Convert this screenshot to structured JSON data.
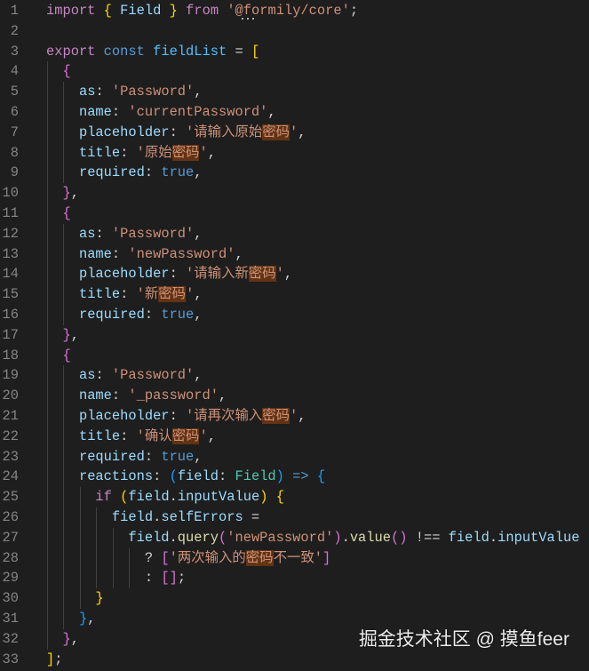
{
  "editor": {
    "colors": {
      "background": "#1e1e1e",
      "text": "#d4d4d4",
      "line_number": "#858585",
      "indent_guide": "#404040",
      "find_match": "#623314"
    },
    "lines": [
      {
        "n": "1",
        "tokens": [
          {
            "text": "import",
            "color": "#c586c0"
          },
          {
            "text": " "
          },
          {
            "text": "{",
            "color": "#ffd700"
          },
          {
            "text": " "
          },
          {
            "text": "Field",
            "color": "#9cdcfe"
          },
          {
            "text": " "
          },
          {
            "text": "}",
            "color": "#ffd700"
          },
          {
            "text": " "
          },
          {
            "text": "from",
            "color": "#c586c0"
          },
          {
            "text": " "
          },
          {
            "text": "'@formily/core'",
            "color": "#ce9178"
          },
          {
            "text": ";"
          }
        ]
      },
      {
        "n": "2",
        "tokens": []
      },
      {
        "n": "3",
        "tokens": [
          {
            "text": "export",
            "color": "#c586c0"
          },
          {
            "text": " "
          },
          {
            "text": "const",
            "color": "#569cd6"
          },
          {
            "text": " "
          },
          {
            "text": "fieldList",
            "color": "#4fc1ff"
          },
          {
            "text": " = "
          },
          {
            "text": "[",
            "color": "#ffd700"
          }
        ]
      },
      {
        "n": "4",
        "tokens": [
          {
            "text": "  "
          },
          {
            "text": "{",
            "color": "#da70d6"
          }
        ]
      },
      {
        "n": "5",
        "tokens": [
          {
            "text": "    "
          },
          {
            "text": "as",
            "color": "#9cdcfe"
          },
          {
            "text": ": "
          },
          {
            "text": "'Password'",
            "color": "#ce9178"
          },
          {
            "text": ","
          }
        ]
      },
      {
        "n": "6",
        "tokens": [
          {
            "text": "    "
          },
          {
            "text": "name",
            "color": "#9cdcfe"
          },
          {
            "text": ": "
          },
          {
            "text": "'currentPassword'",
            "color": "#ce9178"
          },
          {
            "text": ","
          }
        ]
      },
      {
        "n": "7",
        "tokens": [
          {
            "text": "    "
          },
          {
            "text": "placeholder",
            "color": "#9cdcfe"
          },
          {
            "text": ": "
          },
          {
            "text": "'请输入原始",
            "color": "#ce9178"
          },
          {
            "text": "密码",
            "color": "#ce9178",
            "match": true
          },
          {
            "text": "'",
            "color": "#ce9178"
          },
          {
            "text": ","
          }
        ]
      },
      {
        "n": "8",
        "tokens": [
          {
            "text": "    "
          },
          {
            "text": "title",
            "color": "#9cdcfe"
          },
          {
            "text": ": "
          },
          {
            "text": "'原始",
            "color": "#ce9178"
          },
          {
            "text": "密码",
            "color": "#ce9178",
            "match": true
          },
          {
            "text": "'",
            "color": "#ce9178"
          },
          {
            "text": ","
          }
        ]
      },
      {
        "n": "9",
        "tokens": [
          {
            "text": "    "
          },
          {
            "text": "required",
            "color": "#9cdcfe"
          },
          {
            "text": ": "
          },
          {
            "text": "true",
            "color": "#569cd6"
          },
          {
            "text": ","
          }
        ]
      },
      {
        "n": "10",
        "tokens": [
          {
            "text": "  "
          },
          {
            "text": "}",
            "color": "#da70d6"
          },
          {
            "text": ","
          }
        ]
      },
      {
        "n": "11",
        "tokens": [
          {
            "text": "  "
          },
          {
            "text": "{",
            "color": "#da70d6"
          }
        ]
      },
      {
        "n": "12",
        "tokens": [
          {
            "text": "    "
          },
          {
            "text": "as",
            "color": "#9cdcfe"
          },
          {
            "text": ": "
          },
          {
            "text": "'Password'",
            "color": "#ce9178"
          },
          {
            "text": ","
          }
        ]
      },
      {
        "n": "13",
        "tokens": [
          {
            "text": "    "
          },
          {
            "text": "name",
            "color": "#9cdcfe"
          },
          {
            "text": ": "
          },
          {
            "text": "'newPassword'",
            "color": "#ce9178"
          },
          {
            "text": ","
          }
        ]
      },
      {
        "n": "14",
        "tokens": [
          {
            "text": "    "
          },
          {
            "text": "placeholder",
            "color": "#9cdcfe"
          },
          {
            "text": ": "
          },
          {
            "text": "'请输入新",
            "color": "#ce9178"
          },
          {
            "text": "密码",
            "color": "#ce9178",
            "match": true
          },
          {
            "text": "'",
            "color": "#ce9178"
          },
          {
            "text": ","
          }
        ]
      },
      {
        "n": "15",
        "tokens": [
          {
            "text": "    "
          },
          {
            "text": "title",
            "color": "#9cdcfe"
          },
          {
            "text": ": "
          },
          {
            "text": "'新",
            "color": "#ce9178"
          },
          {
            "text": "密码",
            "color": "#ce9178",
            "match": true
          },
          {
            "text": "'",
            "color": "#ce9178"
          },
          {
            "text": ","
          }
        ]
      },
      {
        "n": "16",
        "tokens": [
          {
            "text": "    "
          },
          {
            "text": "required",
            "color": "#9cdcfe"
          },
          {
            "text": ": "
          },
          {
            "text": "true",
            "color": "#569cd6"
          },
          {
            "text": ","
          }
        ]
      },
      {
        "n": "17",
        "tokens": [
          {
            "text": "  "
          },
          {
            "text": "}",
            "color": "#da70d6"
          },
          {
            "text": ","
          }
        ]
      },
      {
        "n": "18",
        "tokens": [
          {
            "text": "  "
          },
          {
            "text": "{",
            "color": "#da70d6"
          }
        ]
      },
      {
        "n": "19",
        "tokens": [
          {
            "text": "    "
          },
          {
            "text": "as",
            "color": "#9cdcfe"
          },
          {
            "text": ": "
          },
          {
            "text": "'Password'",
            "color": "#ce9178"
          },
          {
            "text": ","
          }
        ]
      },
      {
        "n": "20",
        "tokens": [
          {
            "text": "    "
          },
          {
            "text": "name",
            "color": "#9cdcfe"
          },
          {
            "text": ": "
          },
          {
            "text": "'_password'",
            "color": "#ce9178"
          },
          {
            "text": ","
          }
        ]
      },
      {
        "n": "21",
        "tokens": [
          {
            "text": "    "
          },
          {
            "text": "placeholder",
            "color": "#9cdcfe"
          },
          {
            "text": ": "
          },
          {
            "text": "'请再次输入",
            "color": "#ce9178"
          },
          {
            "text": "密码",
            "color": "#ce9178",
            "match": true
          },
          {
            "text": "'",
            "color": "#ce9178"
          },
          {
            "text": ","
          }
        ]
      },
      {
        "n": "22",
        "tokens": [
          {
            "text": "    "
          },
          {
            "text": "title",
            "color": "#9cdcfe"
          },
          {
            "text": ": "
          },
          {
            "text": "'确认",
            "color": "#ce9178"
          },
          {
            "text": "密码",
            "color": "#ce9178",
            "match": true
          },
          {
            "text": "'",
            "color": "#ce9178"
          },
          {
            "text": ","
          }
        ]
      },
      {
        "n": "23",
        "tokens": [
          {
            "text": "    "
          },
          {
            "text": "required",
            "color": "#9cdcfe"
          },
          {
            "text": ": "
          },
          {
            "text": "true",
            "color": "#569cd6"
          },
          {
            "text": ","
          }
        ]
      },
      {
        "n": "24",
        "tokens": [
          {
            "text": "    "
          },
          {
            "text": "reactions",
            "color": "#9cdcfe"
          },
          {
            "text": ": "
          },
          {
            "text": "(",
            "color": "#179fff"
          },
          {
            "text": "field",
            "color": "#9cdcfe"
          },
          {
            "text": ": "
          },
          {
            "text": "Field",
            "color": "#4ec9b0"
          },
          {
            "text": ")",
            "color": "#179fff"
          },
          {
            "text": " "
          },
          {
            "text": "=>",
            "color": "#569cd6"
          },
          {
            "text": " "
          },
          {
            "text": "{",
            "color": "#179fff"
          }
        ]
      },
      {
        "n": "25",
        "tokens": [
          {
            "text": "      "
          },
          {
            "text": "if",
            "color": "#c586c0"
          },
          {
            "text": " "
          },
          {
            "text": "(",
            "color": "#ffd700"
          },
          {
            "text": "field",
            "color": "#9cdcfe"
          },
          {
            "text": "."
          },
          {
            "text": "inputValue",
            "color": "#9cdcfe"
          },
          {
            "text": ")",
            "color": "#ffd700"
          },
          {
            "text": " "
          },
          {
            "text": "{",
            "color": "#ffd700"
          }
        ]
      },
      {
        "n": "26",
        "tokens": [
          {
            "text": "        "
          },
          {
            "text": "field",
            "color": "#9cdcfe"
          },
          {
            "text": "."
          },
          {
            "text": "selfErrors",
            "color": "#9cdcfe"
          },
          {
            "text": " ="
          }
        ]
      },
      {
        "n": "27",
        "tokens": [
          {
            "text": "          "
          },
          {
            "text": "field",
            "color": "#9cdcfe"
          },
          {
            "text": "."
          },
          {
            "text": "query",
            "color": "#dcdcaa"
          },
          {
            "text": "(",
            "color": "#da70d6"
          },
          {
            "text": "'newPassword'",
            "color": "#ce9178"
          },
          {
            "text": ")",
            "color": "#da70d6"
          },
          {
            "text": "."
          },
          {
            "text": "value",
            "color": "#dcdcaa"
          },
          {
            "text": "()",
            "color": "#da70d6"
          },
          {
            "text": " !== "
          },
          {
            "text": "field",
            "color": "#9cdcfe"
          },
          {
            "text": "."
          },
          {
            "text": "inputValue",
            "color": "#9cdcfe"
          }
        ]
      },
      {
        "n": "28",
        "tokens": [
          {
            "text": "            "
          },
          {
            "text": "? "
          },
          {
            "text": "[",
            "color": "#da70d6"
          },
          {
            "text": "'两次输入的",
            "color": "#ce9178"
          },
          {
            "text": "密码",
            "color": "#ce9178",
            "match": true
          },
          {
            "text": "不一致'",
            "color": "#ce9178"
          },
          {
            "text": "]",
            "color": "#da70d6"
          }
        ]
      },
      {
        "n": "29",
        "tokens": [
          {
            "text": "            "
          },
          {
            "text": ": "
          },
          {
            "text": "[]",
            "color": "#da70d6"
          },
          {
            "text": ";"
          }
        ]
      },
      {
        "n": "30",
        "tokens": [
          {
            "text": "      "
          },
          {
            "text": "}",
            "color": "#ffd700"
          }
        ]
      },
      {
        "n": "31",
        "tokens": [
          {
            "text": "    "
          },
          {
            "text": "}",
            "color": "#179fff"
          },
          {
            "text": ","
          }
        ]
      },
      {
        "n": "32",
        "tokens": [
          {
            "text": "  "
          },
          {
            "text": "}",
            "color": "#da70d6"
          },
          {
            "text": ","
          }
        ]
      },
      {
        "n": "33",
        "tokens": [
          {
            "text": "]",
            "color": "#ffd700"
          },
          {
            "text": ";"
          }
        ]
      }
    ]
  },
  "watermark": {
    "text": "掘金技术社区 @ 摸鱼feer"
  }
}
